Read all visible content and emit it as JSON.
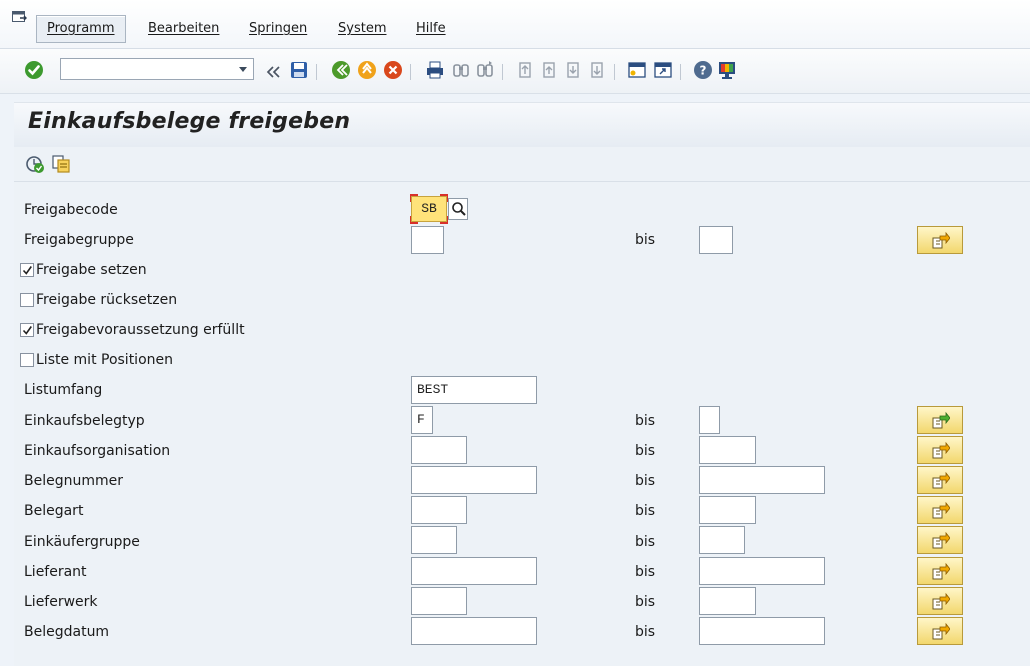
{
  "menu": {
    "items": [
      "Programm",
      "Bearbeiten",
      "Springen",
      "System",
      "Hilfe"
    ]
  },
  "toolbar": {
    "command_field_value": "",
    "icons": [
      "enter-icon",
      "expand-history-icon",
      "save-icon",
      "back-icon",
      "exit-icon",
      "cancel-icon",
      "print-icon",
      "find-icon",
      "find-next-icon",
      "first-page-icon",
      "previous-page-icon",
      "next-page-icon",
      "last-page-icon",
      "new-session-icon",
      "shortcut-icon",
      "help-icon",
      "customize-layout-icon"
    ]
  },
  "page": {
    "title": "Einkaufsbelege freigeben"
  },
  "app_toolbar": {
    "icons": [
      "execute-icon",
      "get-variant-icon"
    ]
  },
  "form": {
    "bis": "bis",
    "freigabecode": {
      "label": "Freigabecode",
      "value": "SB"
    },
    "freigabegruppe": {
      "label": "Freigabegruppe",
      "from": "",
      "to": ""
    },
    "freigabe_setzen": {
      "label": "Freigabe setzen",
      "checked": true
    },
    "freigabe_ruecksetzen": {
      "label": "Freigabe rücksetzen",
      "checked": false
    },
    "freigabevoraussetzung": {
      "label": "Freigabevoraussetzung erfüllt",
      "checked": true
    },
    "liste_positionen": {
      "label": "Liste mit Positionen",
      "checked": false
    },
    "listumfang": {
      "label": "Listumfang",
      "value": "BEST"
    },
    "einkaufsbelegtyp": {
      "label": "Einkaufsbelegtyp",
      "from": "F",
      "to": ""
    },
    "einkaufsorganisation": {
      "label": "Einkaufsorganisation",
      "from": "",
      "to": ""
    },
    "belegnummer": {
      "label": "Belegnummer",
      "from": "",
      "to": ""
    },
    "belegart": {
      "label": "Belegart",
      "from": "",
      "to": ""
    },
    "einkaeufergruppe": {
      "label": "Einkäufergruppe",
      "from": "",
      "to": ""
    },
    "lieferant": {
      "label": "Lieferant",
      "from": "",
      "to": ""
    },
    "lieferwerk": {
      "label": "Lieferwerk",
      "from": "",
      "to": ""
    },
    "belegdatum": {
      "label": "Belegdatum",
      "from": "",
      "to": ""
    }
  },
  "colors": {
    "required_field": "#ffe37a",
    "multi_button": "#f2d76d",
    "background": "#edf2f7"
  }
}
